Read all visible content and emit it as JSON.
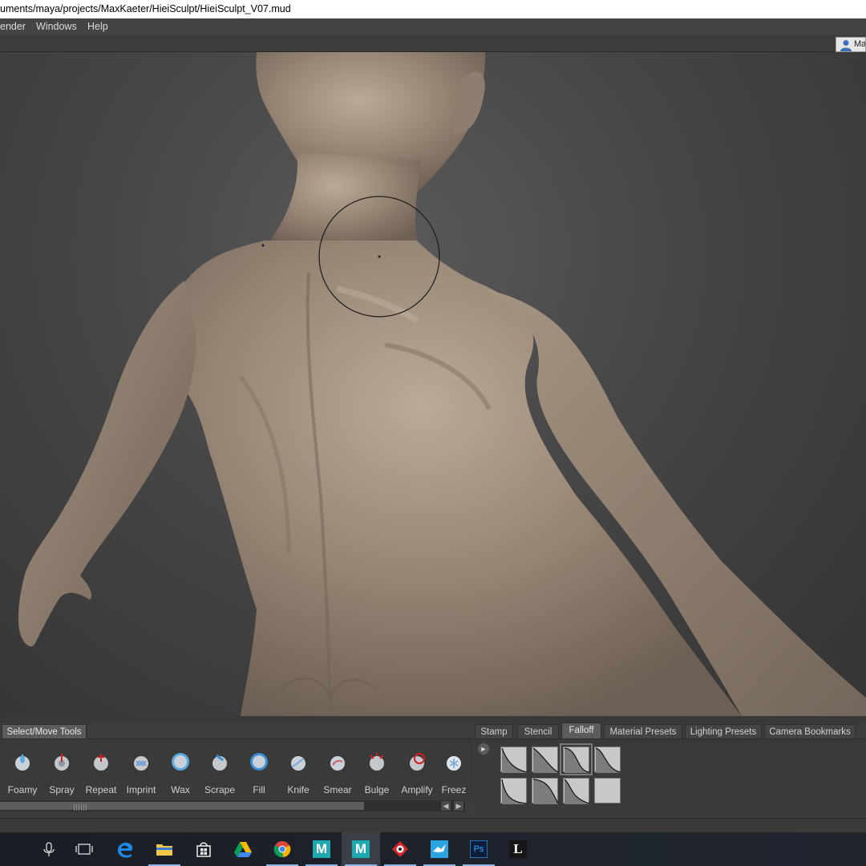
{
  "window": {
    "title": "uments/maya/projects/MaxKaeter/HieiSculpt/HieiSculpt_V07.mud"
  },
  "menu": {
    "items": [
      "ender",
      "Windows",
      "Help"
    ]
  },
  "user": {
    "label": "Ma",
    "icon": "user-icon"
  },
  "panel": {
    "left_tab": "Select/Move Tools",
    "right_tabs": [
      "Stamp",
      "Stencil",
      "Falloff",
      "Material Presets",
      "Lighting Presets",
      "Camera Bookmarks"
    ],
    "active_right_tab": "Falloff"
  },
  "tools": [
    {
      "label": "Foamy",
      "icon": "foamy-icon"
    },
    {
      "label": "Spray",
      "icon": "spray-icon"
    },
    {
      "label": "Repeat",
      "icon": "repeat-icon"
    },
    {
      "label": "Imprint",
      "icon": "imprint-icon"
    },
    {
      "label": "Wax",
      "icon": "wax-icon"
    },
    {
      "label": "Scrape",
      "icon": "scrape-icon"
    },
    {
      "label": "Fill",
      "icon": "fill-icon"
    },
    {
      "label": "Knife",
      "icon": "knife-icon"
    },
    {
      "label": "Smear",
      "icon": "smear-icon"
    },
    {
      "label": "Bulge",
      "icon": "bulge-icon"
    },
    {
      "label": "Amplify",
      "icon": "amplify-icon"
    },
    {
      "label": "Freez",
      "icon": "freeze-icon"
    }
  ],
  "falloff_presets": {
    "selected_index": 2,
    "count": 8
  },
  "taskbar": {
    "apps": [
      {
        "name": "microphone",
        "icon": "microphone-icon"
      },
      {
        "name": "task-view",
        "icon": "task-view-icon"
      },
      {
        "name": "edge",
        "icon": "edge-icon"
      },
      {
        "name": "file-explorer",
        "icon": "folder-icon"
      },
      {
        "name": "store",
        "icon": "store-icon"
      },
      {
        "name": "google-drive",
        "icon": "google-drive-icon"
      },
      {
        "name": "chrome",
        "icon": "chrome-icon"
      },
      {
        "name": "maya",
        "icon": "maya-icon"
      },
      {
        "name": "mudbox",
        "icon": "mudbox-icon"
      },
      {
        "name": "reaper",
        "icon": "reaper-icon"
      },
      {
        "name": "bird-app",
        "icon": "bird-icon"
      },
      {
        "name": "photoshop",
        "icon": "photoshop-icon"
      },
      {
        "name": "lightroom",
        "icon": "l-icon"
      }
    ],
    "ps_text": "Ps",
    "l_text": "L",
    "m_text": "M"
  },
  "colors": {
    "skin": "#9a8878",
    "viewport_bg": "#474747",
    "panel_bg": "#3c3c3c",
    "taskbar_bg": "#1d222b"
  }
}
